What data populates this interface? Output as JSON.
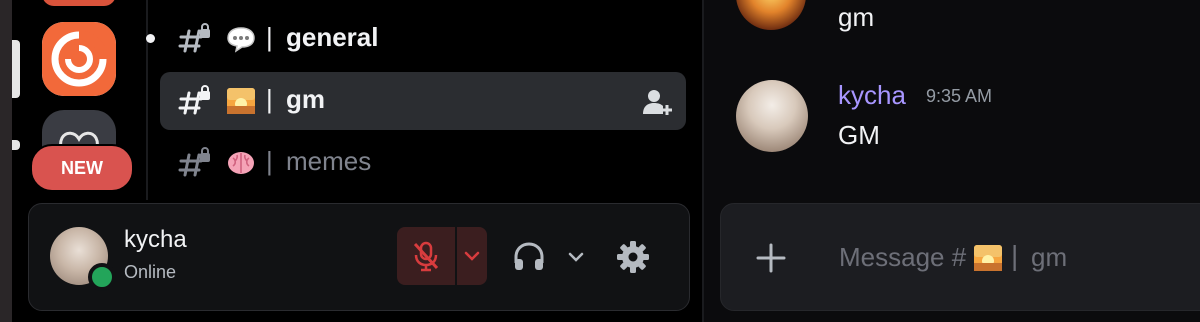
{
  "server_rail": {
    "new_badge": "NEW",
    "colors": {
      "accent_server": "#f26a3a",
      "badge_bg": "#d9534f"
    }
  },
  "channels": [
    {
      "name": "general",
      "separator": "|",
      "emoji": "speech-bubble",
      "locked": true,
      "active": false,
      "unread": true
    },
    {
      "name": "gm",
      "separator": "|",
      "emoji": "sunrise",
      "locked": true,
      "active": true,
      "unread": false
    },
    {
      "name": "memes",
      "separator": "|",
      "emoji": "brain",
      "locked": true,
      "active": false,
      "unread": false
    }
  ],
  "user_panel": {
    "username": "kycha",
    "status": "Online",
    "status_color": "#23a55a",
    "controls": [
      "microphone-muted-icon",
      "chevron-down-icon",
      "headphones-icon",
      "chevron-down-icon",
      "gear-icon"
    ]
  },
  "chat": {
    "previous_message": "gm",
    "message": {
      "author": "kycha",
      "timestamp": "9:35 AM",
      "text": "GM",
      "author_color": "#a896ff"
    },
    "composer": {
      "placeholder_prefix": "Message #",
      "placeholder_separator": "|",
      "placeholder_channel": "gm"
    }
  }
}
